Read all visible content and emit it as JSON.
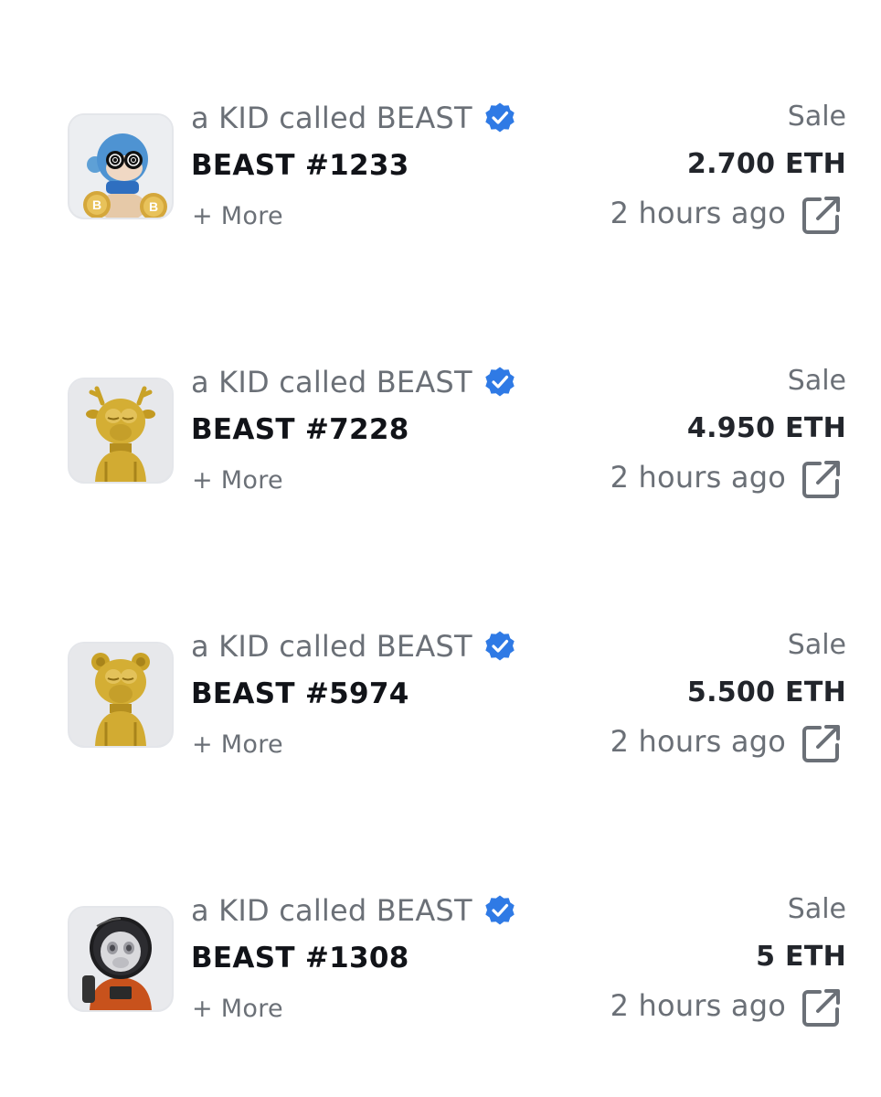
{
  "activity": [
    {
      "collection": "a KID called BEAST",
      "token": "BEAST #1233",
      "more_label": "+ More",
      "event": "Sale",
      "price": "2.700 ETH",
      "time": "2 hours ago",
      "thumbnail": "blue-beast-bitcoin"
    },
    {
      "collection": "a KID called BEAST",
      "token": "BEAST #7228",
      "more_label": "+ More",
      "event": "Sale",
      "price": "4.950 ETH",
      "time": "2 hours ago",
      "thumbnail": "gold-beast-antlers"
    },
    {
      "collection": "a KID called BEAST",
      "token": "BEAST #5974",
      "more_label": "+ More",
      "event": "Sale",
      "price": "5.500 ETH",
      "time": "2 hours ago",
      "thumbnail": "gold-beast-bear-ears"
    },
    {
      "collection": "a KID called BEAST",
      "token": "BEAST #1308",
      "more_label": "+ More",
      "event": "Sale",
      "price": "5 ETH",
      "time": "2 hours ago",
      "thumbnail": "astronaut-beast"
    }
  ],
  "icons": {
    "verified": "verified-badge-icon",
    "external": "external-link-icon"
  },
  "colors": {
    "verified_blue": "#2f7ae5",
    "muted_text": "#6b7077",
    "strong_text": "#111318",
    "gold": "#c9a227"
  }
}
